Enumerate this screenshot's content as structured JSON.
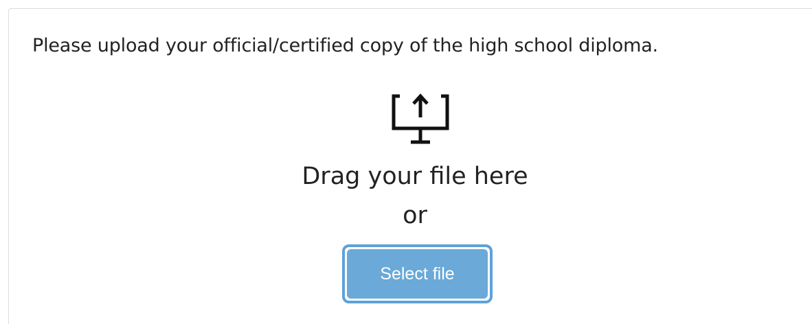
{
  "upload": {
    "instruction": "Please upload your official/certified copy of the high school diploma.",
    "drag_text": "Drag your file here",
    "or_text": "or",
    "select_button_label": "Select file",
    "icon": "upload-monitor-icon"
  },
  "colors": {
    "text": "#222222",
    "button_fill": "#6aa9d8",
    "button_border": "#5ea1d8",
    "button_text": "#ffffff",
    "card_border": "#dcdcdc"
  }
}
